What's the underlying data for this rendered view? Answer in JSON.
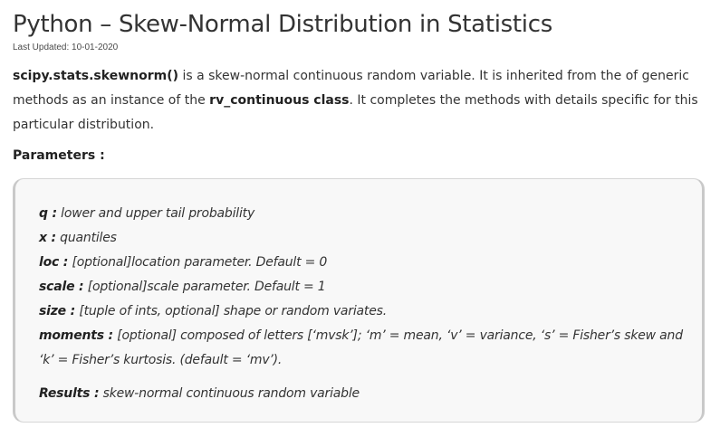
{
  "article": {
    "title": "Python – Skew-Normal Distribution in Statistics",
    "last_updated": "Last Updated: 10-01-2020",
    "intro": {
      "part1_bold": "scipy.stats.skewnorm()",
      "part2": " is a skew-normal continuous random variable. It is inherited from the of generic methods as an instance of the ",
      "part3_bold": "rv_continuous class",
      "part4": ". It completes the methods with details specific for this particular distribution."
    },
    "parameters_heading": "Parameters :",
    "parameters": [
      {
        "key": "q :",
        "text": " lower and upper tail probability"
      },
      {
        "key": "x :",
        "text": " quantiles"
      },
      {
        "key": "loc :",
        "text": " [optional]location parameter. Default = 0"
      },
      {
        "key": "scale :",
        "text": " [optional]scale parameter. Default = 1"
      },
      {
        "key": "size :",
        "text": " [tuple of ints, optional] shape or random variates."
      },
      {
        "key": "moments :",
        "text": " [optional] composed of letters [‘mvsk’]; ‘m’ = mean, ‘v’ = variance, ‘s’ = Fisher’s skew and ‘k’ = Fisher’s kurtosis. (default = ‘mv’)."
      }
    ],
    "results": {
      "key": "Results :",
      "text": " skew-normal continuous random variable"
    }
  }
}
